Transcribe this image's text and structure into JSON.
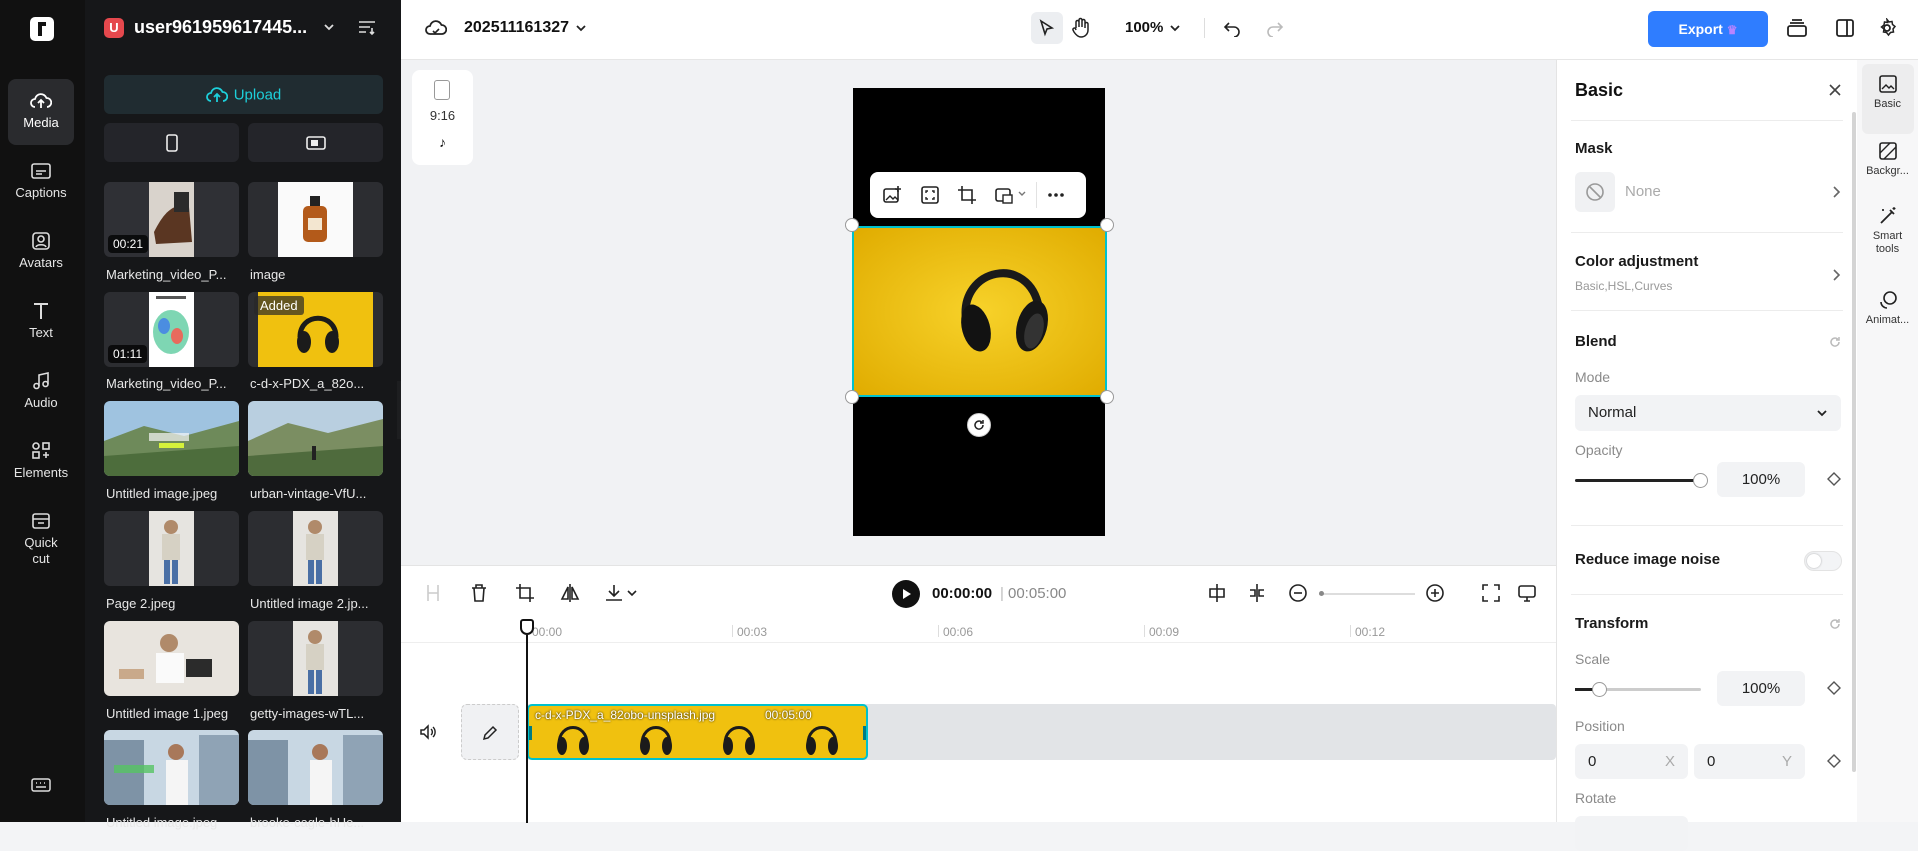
{
  "rail": {
    "items": [
      {
        "label": "Media",
        "icon": "cloud-upload-icon"
      },
      {
        "label": "Captions",
        "icon": "captions-icon"
      },
      {
        "label": "Avatars",
        "icon": "avatar-icon"
      },
      {
        "label": "Text",
        "icon": "text-icon"
      },
      {
        "label": "Audio",
        "icon": "music-icon"
      },
      {
        "label": "Elements",
        "icon": "elements-icon"
      },
      {
        "label": "Quick cut",
        "icon": "quick-cut-icon"
      }
    ]
  },
  "panel": {
    "user_initial": "U",
    "user_name": "user961959617445...",
    "upload_label": "Upload",
    "media": [
      {
        "label": "Marketing_video_P...",
        "duration": "00:21"
      },
      {
        "label": "image",
        "duration": ""
      },
      {
        "label": "Marketing_video_P...",
        "duration": "01:11"
      },
      {
        "label": "c-d-x-PDX_a_82o...",
        "badge": "Added"
      },
      {
        "label": "Untitled image.jpeg",
        "duration": ""
      },
      {
        "label": "urban-vintage-VfU...",
        "duration": ""
      },
      {
        "label": "Page 2.jpeg",
        "duration": ""
      },
      {
        "label": "Untitled image 2.jp...",
        "duration": ""
      },
      {
        "label": "Untitled image 1.jpeg",
        "duration": ""
      },
      {
        "label": "getty-images-wTL...",
        "duration": ""
      },
      {
        "label": "Untitled image.jpeg",
        "duration": ""
      },
      {
        "label": "brooke-cagle-hHe...",
        "duration": ""
      }
    ]
  },
  "topbar": {
    "project_name": "202511161327",
    "zoom": "100%",
    "export_label": "Export"
  },
  "canvas": {
    "ratio_label": "9:16"
  },
  "timeline": {
    "current_time": "00:00:00",
    "total_time": "00:05:00",
    "ticks": [
      "00:00",
      "00:03",
      "00:06",
      "00:09",
      "00:12"
    ],
    "clip_name": "c-d-x-PDX_a_82obo-unsplash.jpg",
    "clip_duration": "00:05:00"
  },
  "props": {
    "title": "Basic",
    "mask_title": "Mask",
    "mask_value": "None",
    "color_title": "Color adjustment",
    "color_sub": "Basic,HSL,Curves",
    "blend_title": "Blend",
    "mode_label": "Mode",
    "mode_value": "Normal",
    "opacity_label": "Opacity",
    "opacity_value": "100%",
    "noise_label": "Reduce image noise",
    "transform_title": "Transform",
    "scale_label": "Scale",
    "scale_value": "100%",
    "position_label": "Position",
    "pos_x": "0",
    "pos_x_axis": "X",
    "pos_y": "0",
    "pos_y_axis": "Y",
    "rotate_label": "Rotate"
  },
  "right_rail": {
    "items": [
      "Basic",
      "Backgr...",
      "Smart tools",
      "Animat..."
    ]
  },
  "colors": {
    "accent": "#00c1cd",
    "export": "#2f7dff",
    "yellow": "#f2c40c"
  }
}
